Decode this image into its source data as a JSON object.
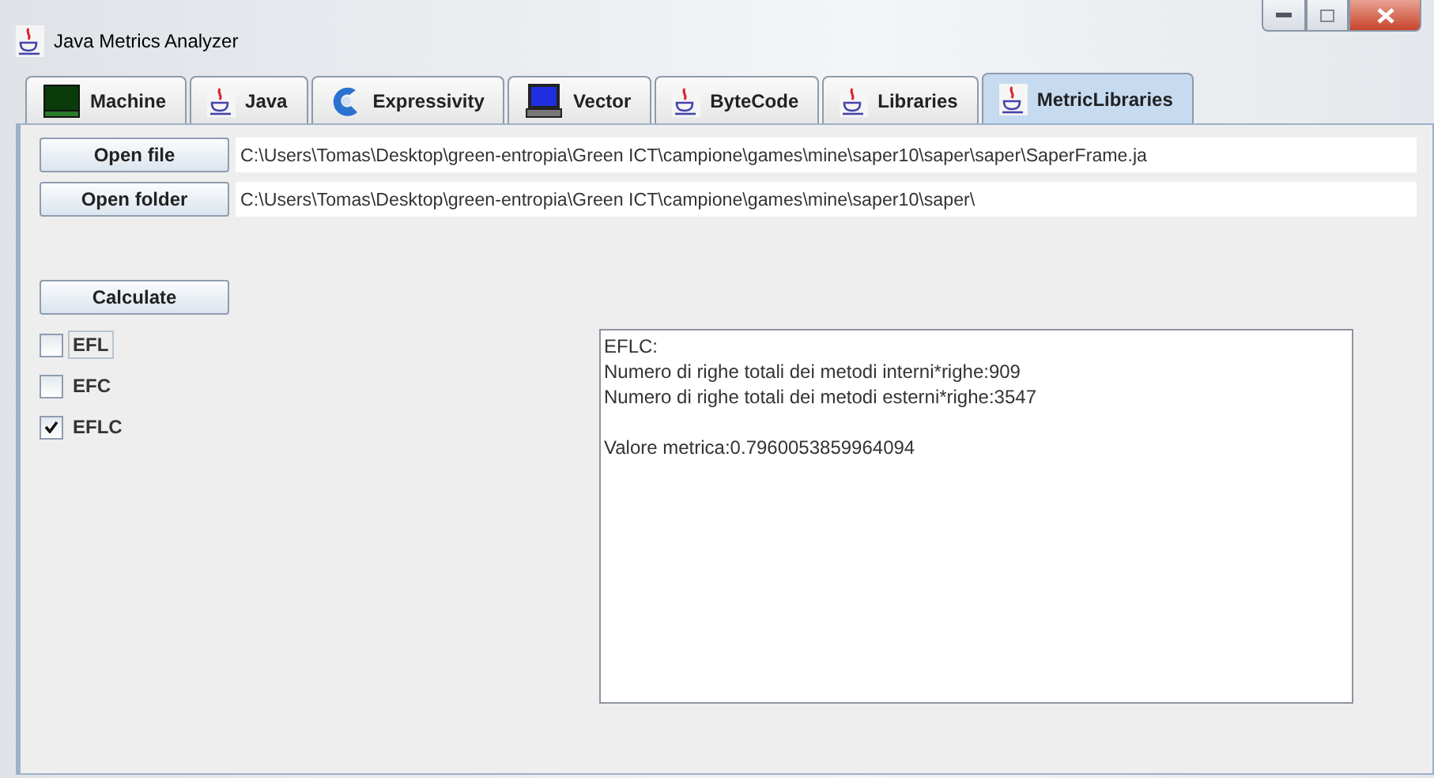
{
  "window": {
    "title": "Java Metrics Analyzer"
  },
  "tabs": [
    {
      "label": "Machine",
      "kind": "green-monitor",
      "selected": false
    },
    {
      "label": "Java",
      "kind": "cup",
      "selected": false
    },
    {
      "label": "Expressivity",
      "kind": "swirl",
      "selected": false
    },
    {
      "label": "Vector",
      "kind": "blue-monitor",
      "selected": false
    },
    {
      "label": "ByteCode",
      "kind": "cup",
      "selected": false
    },
    {
      "label": "Libraries",
      "kind": "cup",
      "selected": false
    },
    {
      "label": "MetricLibraries",
      "kind": "cup",
      "selected": true
    }
  ],
  "file_row": {
    "button": "Open file",
    "path": "C:\\Users\\Tomas\\Desktop\\green-entropia\\Green ICT\\campione\\games\\mine\\saper10\\saper\\saper\\SaperFrame.ja"
  },
  "folder_row": {
    "button": "Open folder",
    "path": "C:\\Users\\Tomas\\Desktop\\green-entropia\\Green ICT\\campione\\games\\mine\\saper10\\saper\\"
  },
  "calculate_button": "Calculate",
  "metrics": [
    {
      "label": "EFL",
      "checked": false,
      "focused": true
    },
    {
      "label": "EFC",
      "checked": false,
      "focused": false
    },
    {
      "label": "EFLC",
      "checked": true,
      "focused": false
    }
  ],
  "output": {
    "lines": [
      "EFLC:",
      "Numero di righe totali dei metodi interni*righe:909",
      "Numero di righe totali dei metodi esterni*righe:3547"
    ],
    "result": "Valore metrica:0.7960053859964094"
  }
}
